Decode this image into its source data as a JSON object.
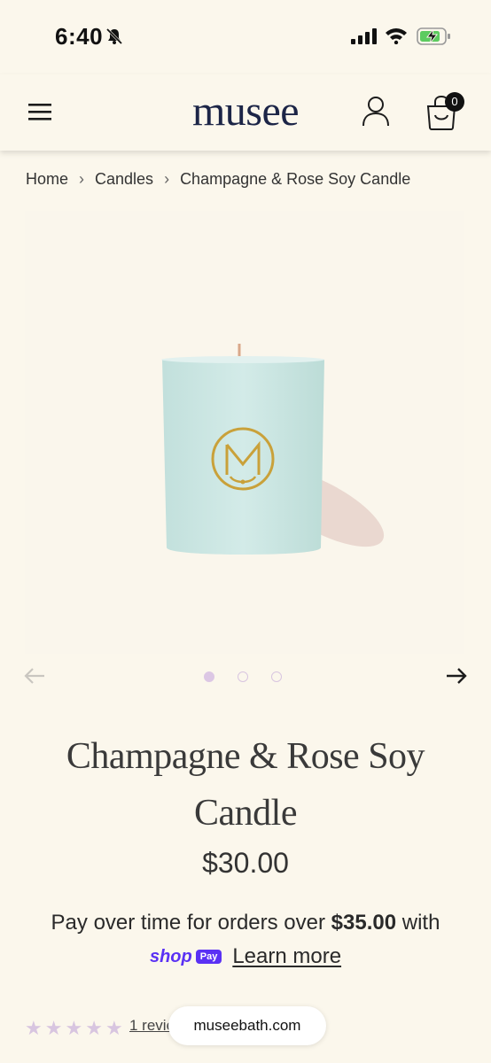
{
  "status_bar": {
    "time": "6:40"
  },
  "header": {
    "logo": "musee",
    "cart_count": "0"
  },
  "breadcrumb": [
    "Home",
    "Candles",
    "Champagne & Rose Soy Candle"
  ],
  "product": {
    "title_line1": "Champagne & Rose Soy",
    "title_line2": "Candle",
    "price": "$30.00",
    "pay_text_pre": "Pay over time for orders over ",
    "pay_amount": "$35.00",
    "pay_text_post": " with",
    "shop_brand": "shop",
    "shop_pay_badge": "Pay",
    "learn_more": "Learn more",
    "reviews_link": "1 review",
    "rating": 0
  },
  "carousel": {
    "slides": 3,
    "active": 0
  },
  "browser": {
    "url": "museebath.com"
  },
  "colors": {
    "background": "#fbf7ec",
    "logo": "#1c2547",
    "accent_lilac": "#dcc7e4",
    "shop_purple": "#5a31f4",
    "candle": "#cfe6e3",
    "gold": "#c9a13a"
  }
}
